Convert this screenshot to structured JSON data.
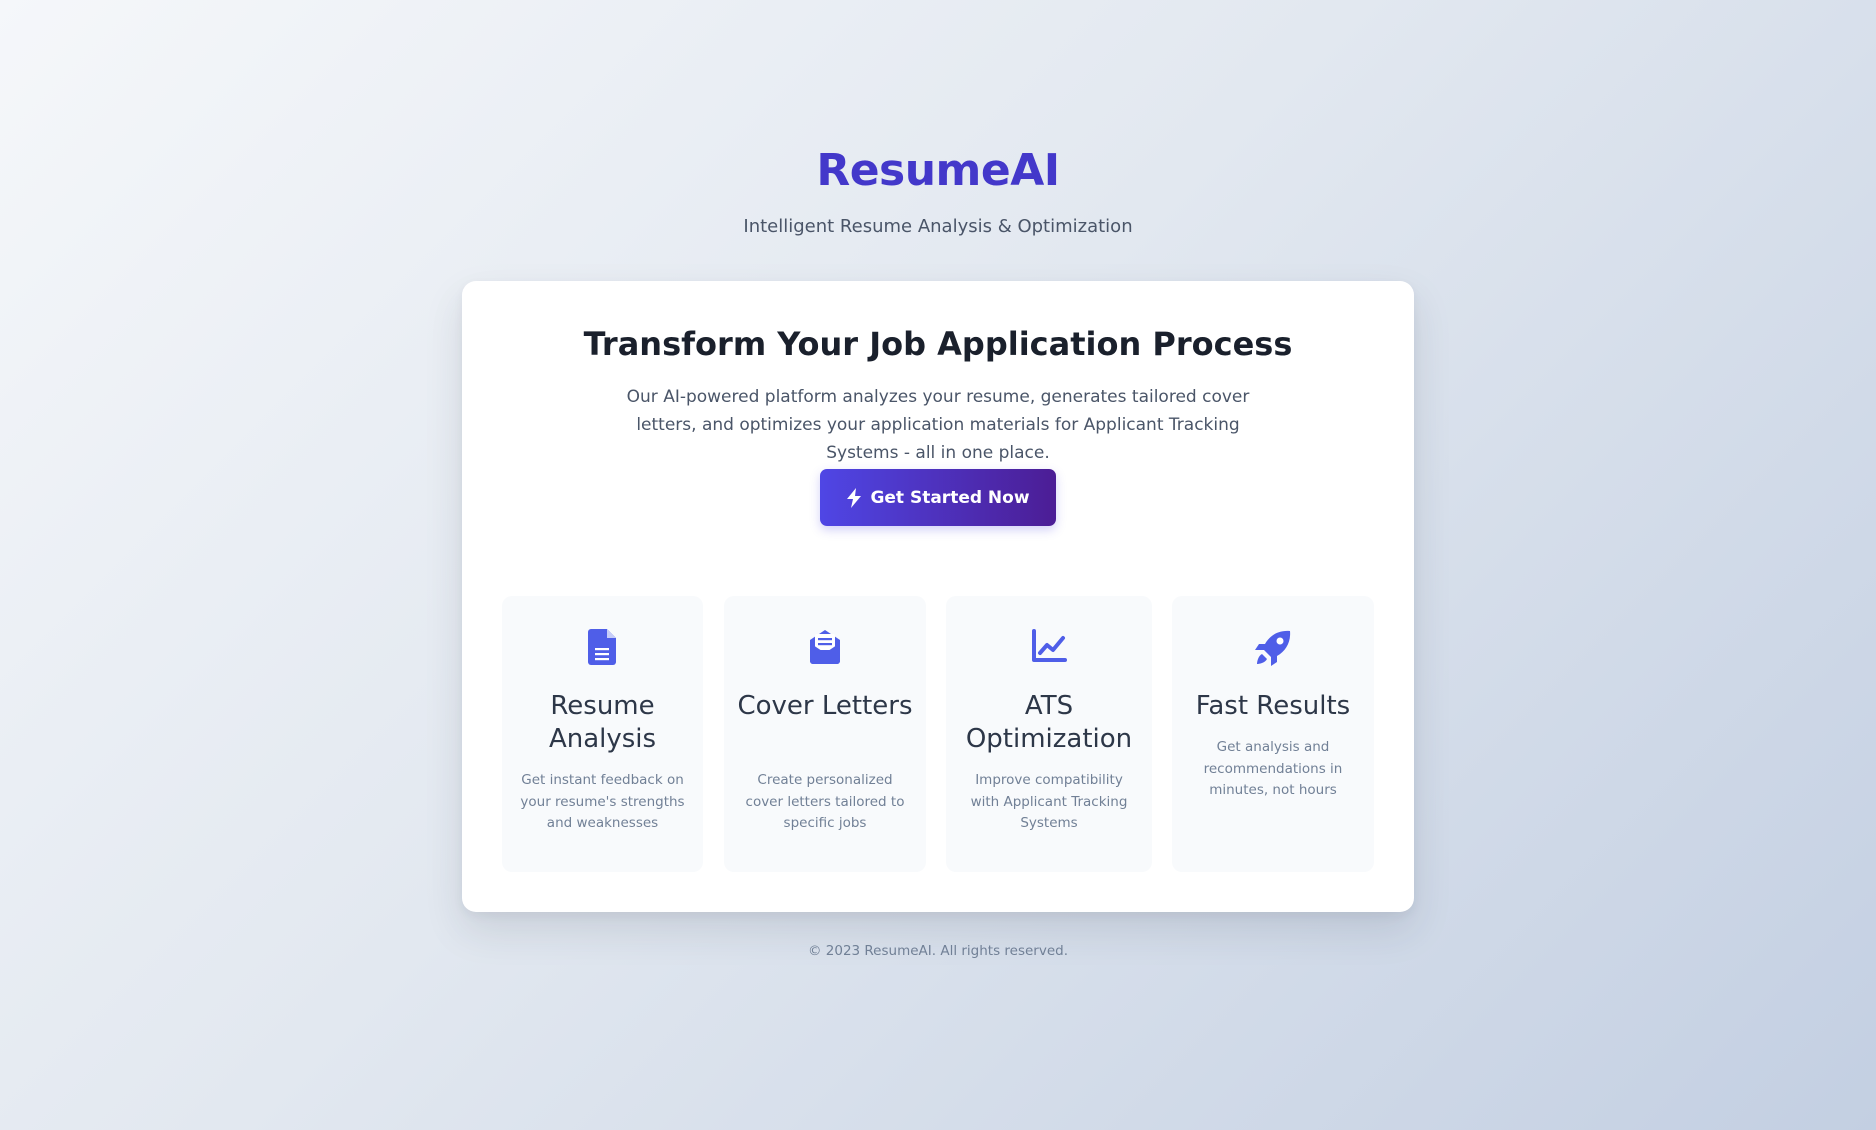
{
  "brand": {
    "name": "ResumeAI",
    "tagline": "Intelligent Resume Analysis & Optimization"
  },
  "hero": {
    "title": "Transform Your Job Application Process",
    "description": "Our AI-powered platform analyzes your resume, generates tailored cover letters, and optimizes your application materials for Applicant Tracking Systems - all in one place.",
    "cta_label": "Get Started Now",
    "cta_icon": "bolt-icon"
  },
  "features": [
    {
      "icon": "file-document-icon",
      "title": "Resume Analysis",
      "description": "Get instant feedback on your resume's strengths and weaknesses"
    },
    {
      "icon": "envelope-open-text-icon",
      "title": "Cover Letters",
      "description": "Create personalized cover letters tailored to specific jobs"
    },
    {
      "icon": "chart-line-icon",
      "title": "ATS Optimization",
      "description": "Improve compatibility with Applicant Tracking Systems"
    },
    {
      "icon": "rocket-icon",
      "title": "Fast Results",
      "description": "Get analysis and recommendations in minutes, not hours"
    }
  ],
  "footer": {
    "copyright": "© 2023 ResumeAI. All rights reserved."
  },
  "colors": {
    "brand": "#4338ca",
    "accent": "#4f46e5",
    "accent_dark": "#4c1d95",
    "icon": "#4f5ee8"
  }
}
